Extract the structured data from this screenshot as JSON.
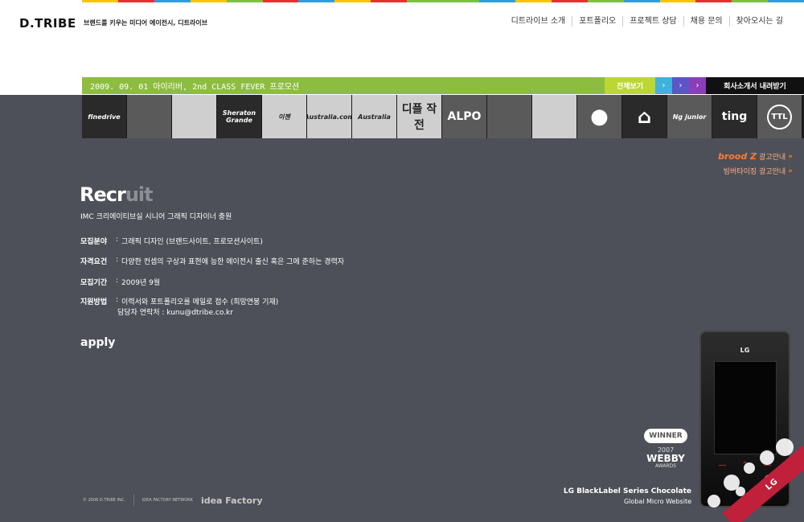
{
  "header": {
    "logo": "D.TRIBE",
    "tagline": "브랜드를 키우는 미디어 에이전시, 디트라이브",
    "stripe_colors": [
      "#f6c400",
      "#e83030",
      "#2e9fd8",
      "#f6c400",
      "#7cc23f",
      "#e83030",
      "#2e9fd8",
      "#f6c400",
      "#e83030",
      "#7cc23f",
      "#7cc23f",
      "#2e9fd8",
      "#f6c400",
      "#e83030",
      "#7cc23f",
      "#2e9fd8",
      "#f6c400",
      "#e83030",
      "#7cc23f",
      "#2e9fd8"
    ],
    "nav": [
      {
        "label": "디트라이브 소개"
      },
      {
        "label": "포트폴리오"
      },
      {
        "label": "프로젝트 상담"
      },
      {
        "label": "채용 문의"
      },
      {
        "label": "찾아오시는 길"
      }
    ]
  },
  "newsbar": {
    "text": "2009. 09. 01  아이리버, 2nd CLASS FEVER 프로모션",
    "view_all": "전체보기",
    "arrow": "›",
    "download": "회사소개서 내려받기"
  },
  "thumbnails": [
    {
      "label": "finedrive",
      "icon": "finedrive-logo"
    },
    {
      "label": "",
      "icon": "child-photo"
    },
    {
      "label": "",
      "icon": "baby-photo"
    },
    {
      "label": "Sheraton Grande",
      "icon": "sheraton-logo"
    },
    {
      "label": "이젠",
      "icon": "ezen-logo"
    },
    {
      "label": "Australia.com",
      "icon": "kangaroo-logo"
    },
    {
      "label": "Australia",
      "icon": "australia-logo"
    },
    {
      "label": "디플 작전",
      "icon": "dipl-logo"
    },
    {
      "label": "ALPO",
      "icon": "alpo-logo"
    },
    {
      "label": "",
      "icon": "sketch-illustration"
    },
    {
      "label": "",
      "icon": "car-illustration"
    },
    {
      "label": "",
      "icon": "mouse-ears-logo"
    },
    {
      "label": "",
      "icon": "house-logo"
    },
    {
      "label": "Ng junior",
      "icon": "ng-junior-logo"
    },
    {
      "label": "ting",
      "icon": "ting-logo"
    },
    {
      "label": "TTL",
      "icon": "ttl-logo"
    }
  ],
  "ads": {
    "broodz_brand": "brood Z",
    "broodz_label": "광고안내",
    "branding_label": "빙버타이징 광고안내",
    "chevron": "»"
  },
  "recruit": {
    "title_main": "Recr",
    "title_fade": "uit",
    "subtitle": "IMC 크리에이티브실 시니어 그래픽 디자이너 충원",
    "items": [
      {
        "label": "모집분야",
        "value": "그래픽 디자인 (브랜드사이트, 프로모션사이트)"
      },
      {
        "label": "자격요건",
        "value": "다양한 컨셉의 구상과 표현에 능한 에이전시 출신 혹은 그에 준하는 경력자"
      },
      {
        "label": "모집기간",
        "value": "2009년 9월"
      },
      {
        "label": "지원방법",
        "value": "이력서와 포트폴리오를 메일로 접수 (희망연봉 기재)"
      }
    ],
    "contact": "담당자 연락처 : kunu@dtribe.co.kr",
    "colon": ":",
    "apply": "apply"
  },
  "footer": {
    "copyright": "© 2006 D.TRIBE INC.",
    "network": "IDEA FACTORY NETWORK",
    "idea": "idea Factory"
  },
  "promo": {
    "winner": "WINNER",
    "year": "2007",
    "webby": "WEBBY",
    "awards": "AWARDS",
    "line1": "LG BlackLabel Series Chocolate",
    "line2": "Global Micro Website",
    "phone_brand": "LG",
    "ribbon": "LG"
  }
}
